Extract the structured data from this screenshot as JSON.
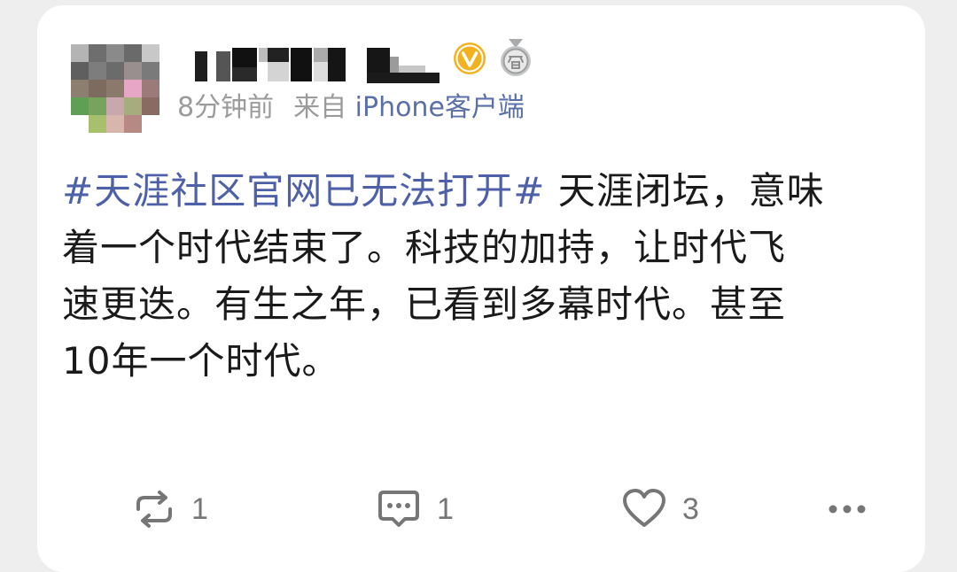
{
  "post": {
    "author": {
      "name": "",
      "avatar": "pixelated-avatar",
      "verified_icon": "verified-v-badge-icon",
      "badge_icon": "answer-medal-icon",
      "colors": {
        "verified": "#f2b11e",
        "medal": "#a9aaab"
      }
    },
    "meta": {
      "time": "8分钟前",
      "source_prefix": "来自",
      "client": "iPhone客户端"
    },
    "content": {
      "hashtag": "#天涯社区官网已无法打开#",
      "line1_rest": " 天涯闭坛，意味",
      "line2": "着一个时代结束了。科技的加持，让时代飞",
      "line3": "速更迭。有生之年，已看到多幕时代。甚至",
      "line4": "10年一个时代。"
    },
    "colors": {
      "hashtag": "#4e61a8",
      "text": "#1a1a1a",
      "meta": "#9b9b9b",
      "client": "#5b70a8",
      "action": "#767676"
    },
    "actions": {
      "repost": {
        "icon": "repost-icon",
        "count": "1"
      },
      "comment": {
        "icon": "comment-icon",
        "count": "1"
      },
      "like": {
        "icon": "heart-icon",
        "count": "3"
      },
      "more": {
        "icon": "more-dots-icon"
      }
    }
  }
}
